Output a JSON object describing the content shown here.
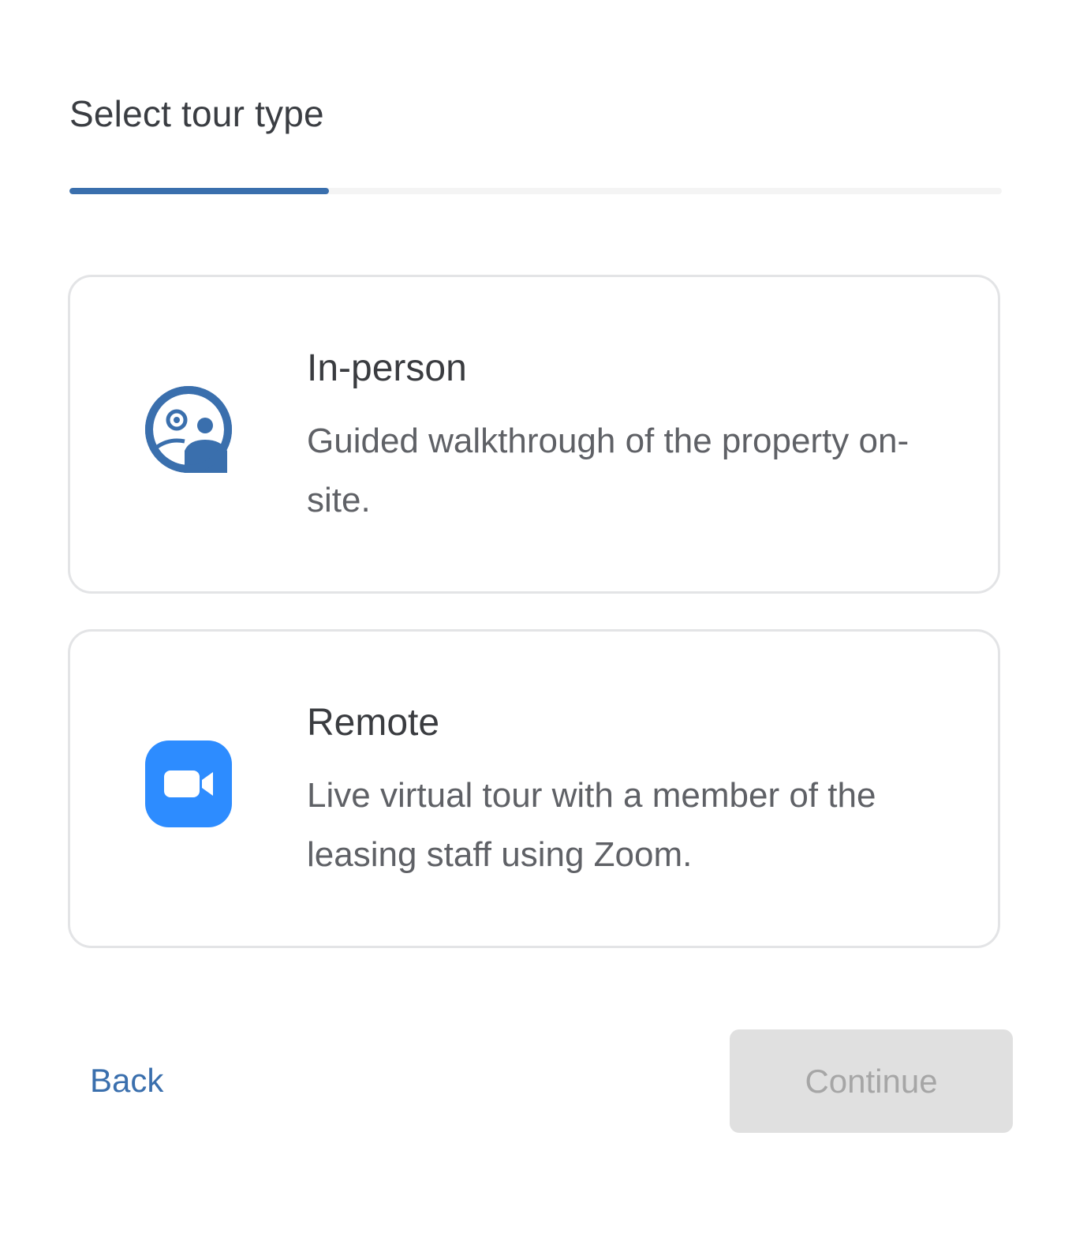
{
  "header": {
    "title": "Select tour type"
  },
  "progress": {
    "fraction": 0.278,
    "color": "#3a6fad"
  },
  "options": [
    {
      "title": "In-person",
      "description": "Guided walkthrough of the property on-site.",
      "icon": "in-person-tour-icon",
      "icon_color": "#3a6fad"
    },
    {
      "title": "Remote",
      "description": "Live virtual tour with a member of the leasing staff using Zoom.",
      "icon": "zoom-video-icon",
      "icon_color": "#2d8cff"
    }
  ],
  "footer": {
    "back_label": "Back",
    "continue_label": "Continue",
    "continue_disabled": true
  }
}
